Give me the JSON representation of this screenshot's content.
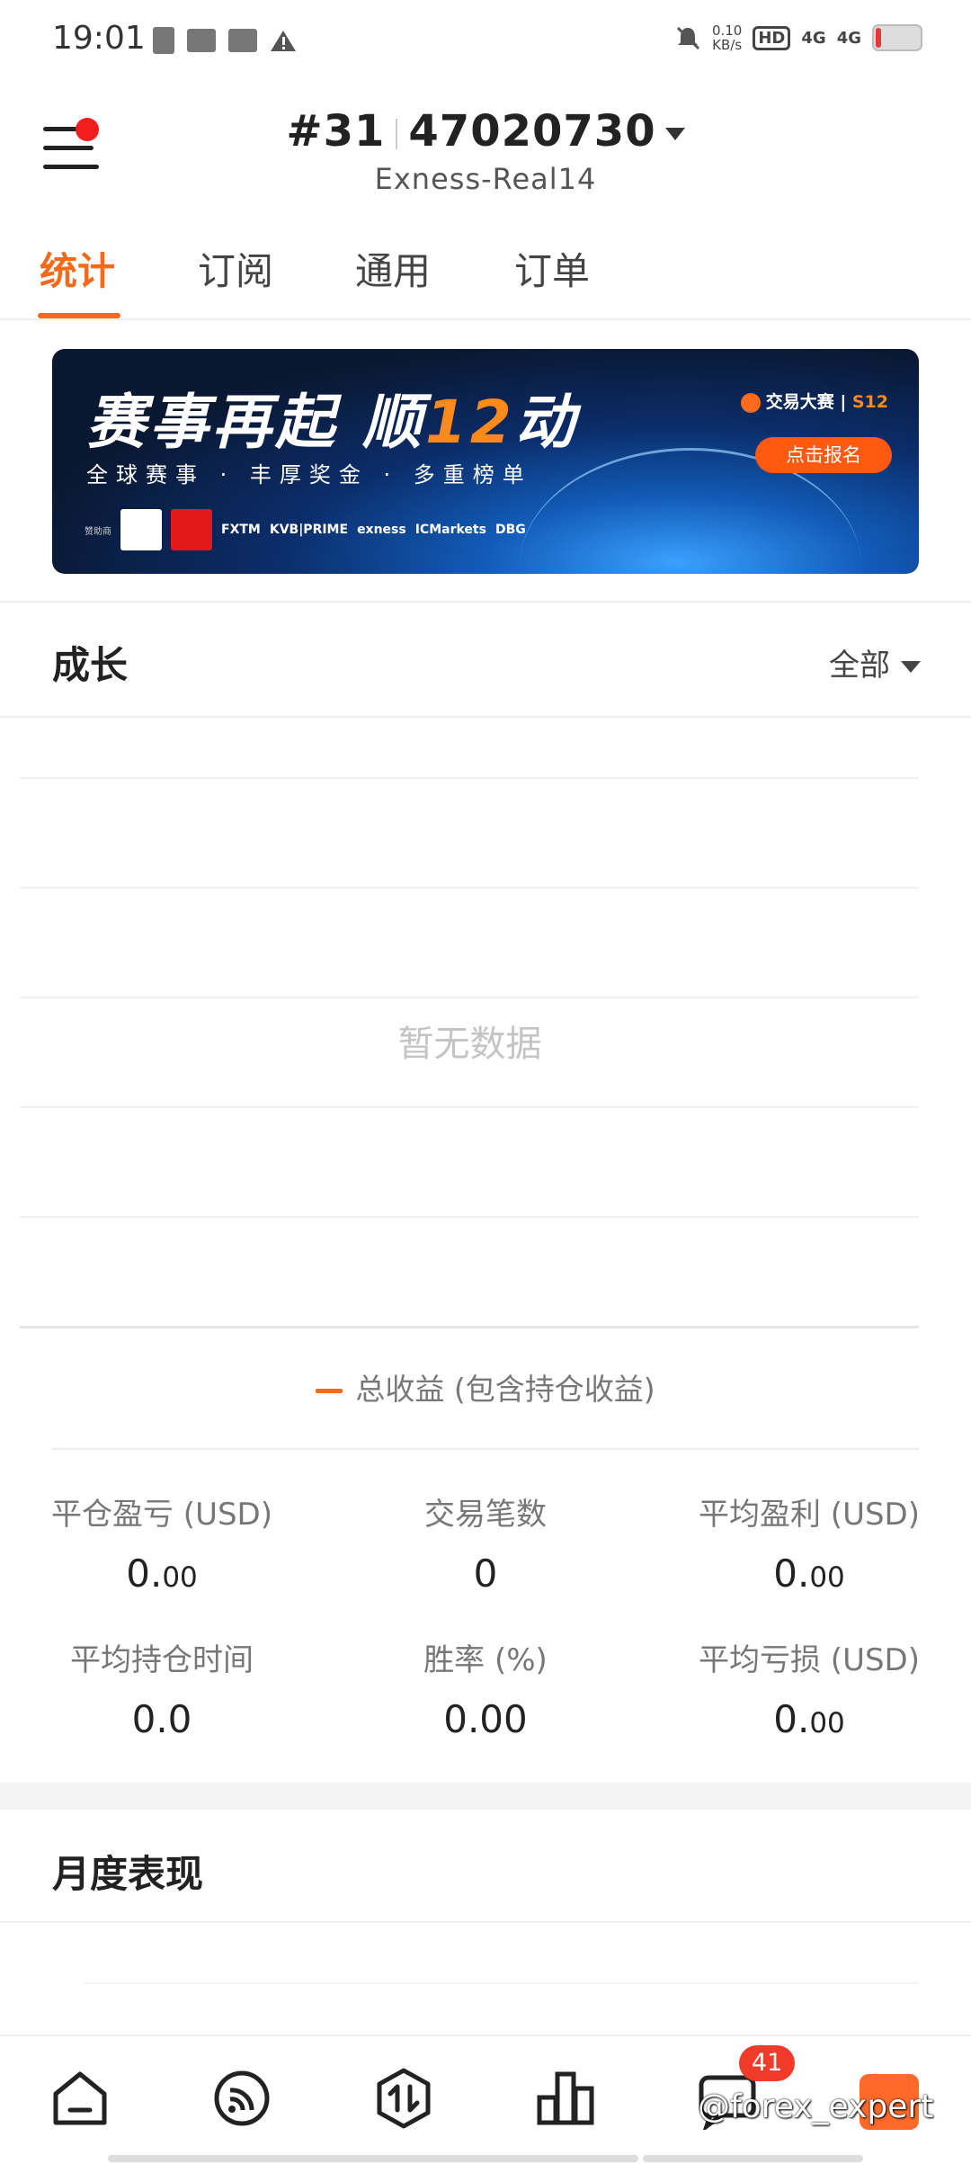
{
  "status_bar": {
    "time": "19:01",
    "net_speed_value": "0.10",
    "net_speed_unit": "KB/s",
    "hd_label": "HD",
    "sim1": "4G",
    "sim2": "4G"
  },
  "header": {
    "account_prefix": "#31",
    "account_number": "47020730",
    "server": "Exness-Real14"
  },
  "tabs": [
    {
      "label": "统计",
      "active": true
    },
    {
      "label": "订阅",
      "active": false
    },
    {
      "label": "通用",
      "active": false
    },
    {
      "label": "订单",
      "active": false
    }
  ],
  "banner": {
    "title_a": "赛事再起 顺",
    "title_num": "12",
    "title_b": "动",
    "subtitle": "全球赛事 · 丰厚奖金 · 多重榜单",
    "brand": "交易大赛",
    "brand_season": "S12",
    "cta": "点击报名",
    "sponsor_label": "赞助商",
    "sponsors": [
      "FXTM",
      "KVB|PRIME",
      "exness",
      "ICMarkets",
      "DBG"
    ]
  },
  "growth": {
    "title": "成长",
    "filter": "全部",
    "empty_text": "暂无数据",
    "legend": "总收益 (包含持仓收益)"
  },
  "stats": {
    "closed_pl_label": "平仓盈亏 (USD)",
    "closed_pl_int": "0.",
    "closed_pl_dec": "00",
    "trades_label": "交易笔数",
    "trades_value": "0",
    "avg_profit_label": "平均盈利 (USD)",
    "avg_profit_int": "0.",
    "avg_profit_dec": "00",
    "avg_hold_label": "平均持仓时间",
    "avg_hold_value": "0.0",
    "win_rate_label": "胜率 (%)",
    "win_rate_value": "0.00",
    "avg_loss_label": "平均亏损 (USD)",
    "avg_loss_int": "0.",
    "avg_loss_dec": "00"
  },
  "monthly": {
    "title": "月度表现"
  },
  "bottom_nav": {
    "items": [
      "home-icon",
      "feed-icon",
      "trade-icon",
      "chart-icon",
      "message-icon",
      "profile-icon"
    ],
    "message_badge": "41",
    "watermark": "@forex_expert"
  },
  "colors": {
    "accent": "#f26a1b",
    "badge": "#f03b2a",
    "notify_dot": "#f21d1d"
  }
}
